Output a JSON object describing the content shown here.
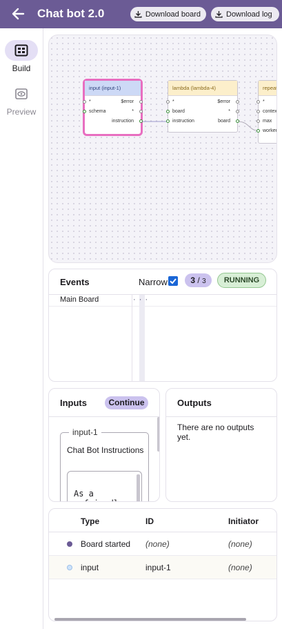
{
  "header": {
    "title": "Chat bot 2.0",
    "download_board": "Download board",
    "download_log": "Download log"
  },
  "rail": {
    "build": "Build",
    "preview": "Preview"
  },
  "graph": {
    "nodes": [
      {
        "title": "input (input-1)",
        "left_ports": [
          "*",
          "schema"
        ],
        "right_ports": [
          "$error",
          "*",
          "instruction"
        ]
      },
      {
        "title": "lambda (lambda-4)",
        "left_ports": [
          "*",
          "board",
          "instruction"
        ],
        "right_ports": [
          "$error",
          "*",
          "board"
        ]
      },
      {
        "title": "repeat",
        "left_ports": [
          "*",
          "context",
          "max",
          "worker"
        ]
      }
    ]
  },
  "events": {
    "title": "Events",
    "narrow_label": "Narrow",
    "narrow_checked": true,
    "count_current": "3",
    "count_separator": " / ",
    "count_total": "3",
    "status": "RUNNING",
    "row_label": "Main Board",
    "marker": "· · ·"
  },
  "inputs": {
    "title": "Inputs",
    "continue_label": "Continue",
    "field_legend": "input-1",
    "field_label": "Chat Bot Instructions",
    "field_value": "As a\n  friendly"
  },
  "outputs": {
    "title": "Outputs",
    "empty_text": "There are no outputs yet."
  },
  "event_table": {
    "columns": [
      "Type",
      "ID",
      "Initiator"
    ],
    "rows": [
      {
        "type": "Board started",
        "id": "(none)",
        "initiator": "(none)",
        "dot_color": "#6b5b95"
      },
      {
        "type": "input",
        "id": "input-1",
        "initiator": "(none)",
        "dot_color": "#cde3fb"
      }
    ]
  },
  "colors": {
    "header_bg": "#6b5b95",
    "accent_pill": "#cbc2ee",
    "running_bg": "#d8efd6",
    "selected_node_border": "#e86ec0",
    "input_node_header": "#cdd9f6",
    "lambda_node_header": "#fcefcb",
    "edge": "#9d98cc"
  }
}
